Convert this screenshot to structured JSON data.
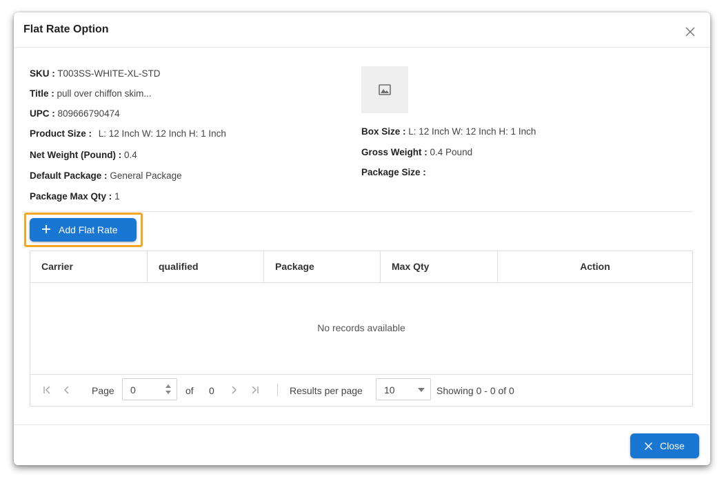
{
  "dialog": {
    "title": "Flat Rate Option"
  },
  "product": {
    "sku_label": "SKU :",
    "sku": "T003SS-WHITE-XL-STD",
    "title_label": "Title :",
    "title": "pull over chiffon skim...",
    "upc_label": "UPC :",
    "upc": "809666790474",
    "product_size_label": "Product Size :",
    "product_size": "L: 12 Inch  W: 12 Inch  H: 1 Inch",
    "net_weight_label": "Net Weight (Pound) :",
    "net_weight": "0.4",
    "default_package_label": "Default Package :",
    "default_package": "General Package",
    "package_max_qty_label": "Package Max Qty :",
    "package_max_qty": "1",
    "box_size_label": "Box Size :",
    "box_size": "L: 12 Inch  W: 12 Inch  H: 1 Inch",
    "gross_weight_label": "Gross Weight :",
    "gross_weight": "0.4 Pound",
    "package_size_label": "Package Size :",
    "package_size": ""
  },
  "actions": {
    "add_flat_rate": "Add Flat Rate",
    "close": "Close"
  },
  "grid": {
    "columns": [
      "Carrier",
      "qualified",
      "Package",
      "Max Qty",
      "Action"
    ],
    "empty_text": "No records available"
  },
  "pager": {
    "page_label": "Page",
    "page_value": "0",
    "of_label": "of",
    "total_pages": "0",
    "results_per_page_label": "Results per page",
    "per_page_value": "10",
    "showing_text": "Showing 0 - 0 of 0"
  },
  "colors": {
    "primary": "#1976d2",
    "highlight": "#f5a623"
  },
  "icons": {
    "close": "close-icon",
    "image_placeholder": "image-icon",
    "add": "plus-icon"
  }
}
